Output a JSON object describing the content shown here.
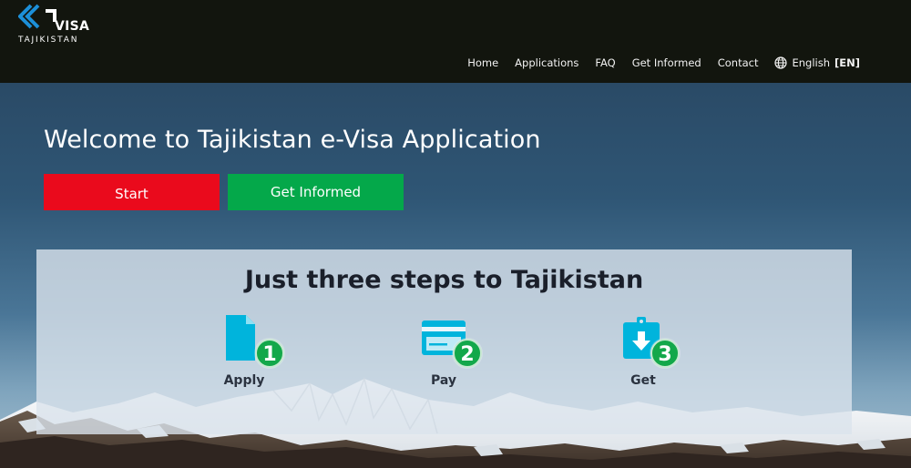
{
  "brand": {
    "logo_word": "VISA",
    "logo_country": "TAJIKISTAN"
  },
  "nav": {
    "items": [
      {
        "label": "Home"
      },
      {
        "label": "Applications"
      },
      {
        "label": "FAQ"
      },
      {
        "label": "Get Informed"
      },
      {
        "label": "Contact"
      }
    ],
    "language": {
      "label": "English",
      "code": "[EN]",
      "icon": "globe-icon"
    }
  },
  "hero": {
    "title": "Welcome to Tajikistan e-Visa Application",
    "start_label": "Start",
    "info_label": "Get Informed"
  },
  "steps": {
    "title": "Just three steps to Tajikistan",
    "items": [
      {
        "label": "Apply",
        "number": "1",
        "icon": "document-icon"
      },
      {
        "label": "Pay",
        "number": "2",
        "icon": "credit-card-icon"
      },
      {
        "label": "Get",
        "number": "3",
        "icon": "download-badge-icon"
      }
    ]
  },
  "colors": {
    "header_bg": "#12150e",
    "start_red": "#ea0a1c",
    "info_green": "#04a84a",
    "icon_blue": "#00b4dc",
    "badge_green": "#13a84a"
  }
}
